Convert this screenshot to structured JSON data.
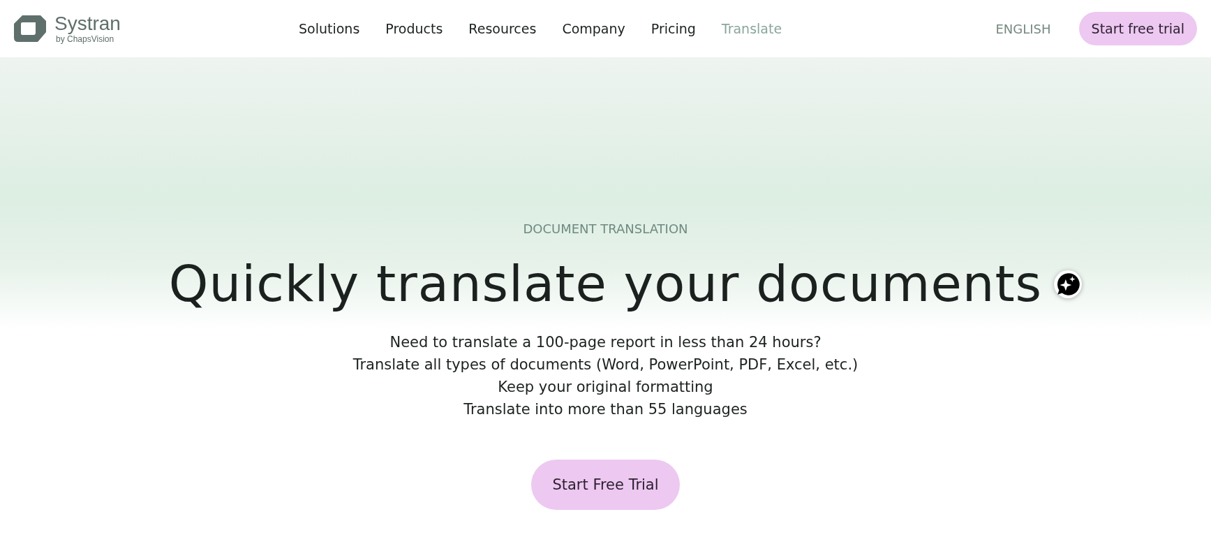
{
  "logo": {
    "name": "Systran",
    "tagline": "by ChapsVision"
  },
  "nav": [
    {
      "label": "Solutions",
      "selected": false
    },
    {
      "label": "Products",
      "selected": false
    },
    {
      "label": "Resources",
      "selected": false
    },
    {
      "label": "Company",
      "selected": false
    },
    {
      "label": "Pricing",
      "selected": false
    },
    {
      "label": "Translate",
      "selected": true
    }
  ],
  "language": "ENGLISH",
  "header_button": "Start free trial",
  "hero": {
    "eyebrow": "DOCUMENT TRANSLATION",
    "title": "Quickly translate your documents",
    "lines": [
      "Need to translate a 100-page report in less than 24 hours?",
      "Translate all types of documents (Word, PowerPoint, PDF, Excel, etc.)",
      "Keep your original formatting",
      "Translate into more than 55 languages"
    ],
    "button": "Start Free Trial"
  }
}
